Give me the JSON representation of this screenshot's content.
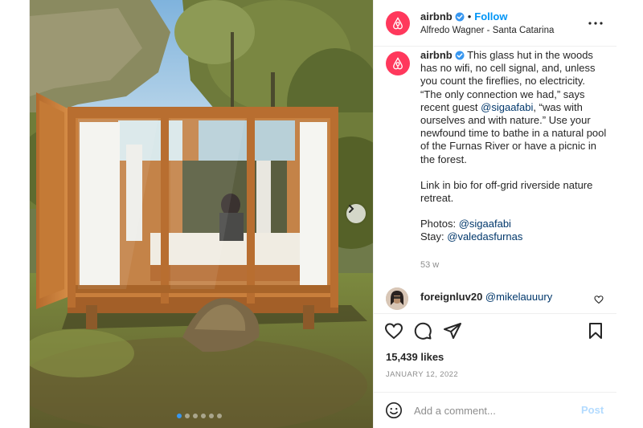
{
  "post": {
    "author": {
      "handle": "airbnb",
      "verified": true,
      "follow_label": "Follow",
      "separator": "•",
      "location": "Alfredo Wagner - Santa Catarina",
      "avatar_color": "#ff385c"
    },
    "more_icon": "more-horizontal-icon",
    "caption": {
      "handle": "airbnb",
      "part1": " This glass hut in the woods has no wifi, no cell signal, and, unless you count the fireflies, no electricity. “The only connection we had,” says recent guest ",
      "mention1": "@sigaafabi",
      "part2": ", “was with ourselves and with nature.” Use your newfound time to bathe in a natural pool of the Furnas River or have a picnic in the forest.",
      "paragraph2": "Link in bio for off-grid riverside nature retreat.",
      "photos_label": "Photos: ",
      "photos_mention": "@sigaafabi",
      "stay_label": "Stay: ",
      "stay_mention": "@valedasfurnas",
      "time": "53 w"
    },
    "comment": {
      "user": "foreignluv20",
      "mention": "@mikelauuury"
    },
    "actions": {
      "like_icon": "heart-icon",
      "comment_icon": "comment-icon",
      "share_icon": "share-icon",
      "save_icon": "bookmark-icon"
    },
    "likes": "15,439 likes",
    "date": "JANUARY 12, 2022",
    "add_comment": {
      "placeholder": "Add a comment...",
      "post_label": "Post"
    },
    "carousel": {
      "slides": 6,
      "current": 1
    }
  },
  "colors": {
    "accent_blue": "#0095f6",
    "brand": "#ff385c",
    "post_disabled": "#b3dbff"
  }
}
